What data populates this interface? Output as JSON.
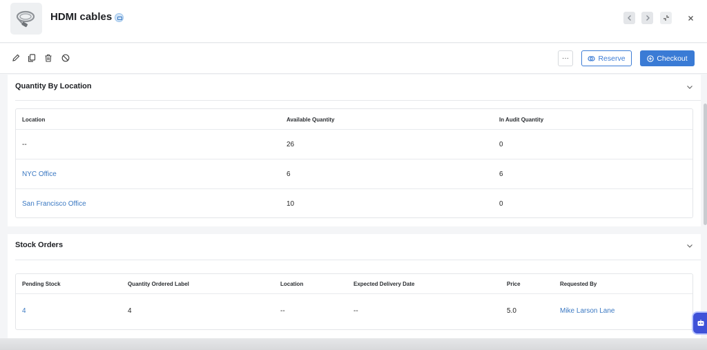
{
  "header": {
    "title": "HDMI cables",
    "thumbnail_icon": "hdmi-cable-icon",
    "prev_icon": "chevron-left-icon",
    "next_icon": "chevron-right-icon",
    "collapse_icon": "collapse-arrows-icon",
    "close_label": "×"
  },
  "toolbar": {
    "edit_icon": "pencil-icon",
    "duplicate_icon": "copy-icon",
    "delete_icon": "trash-icon",
    "disable_icon": "ban-icon",
    "more_label": "···",
    "reserve_label": "Reserve",
    "checkout_label": "Checkout",
    "accent_color": "#3a7bd5"
  },
  "quantity_by_location": {
    "title": "Quantity By Location",
    "columns": [
      "Location",
      "Available Quantity",
      "In Audit Quantity"
    ],
    "rows": [
      {
        "location": "--",
        "available": "26",
        "in_audit": "0"
      },
      {
        "location": "NYC Office",
        "available": "6",
        "in_audit": "6"
      },
      {
        "location": "San Francisco Office",
        "available": "10",
        "in_audit": "0"
      }
    ]
  },
  "stock_orders": {
    "title": "Stock Orders",
    "columns": [
      "Pending Stock",
      "Quantity Ordered Label",
      "Location",
      "Expected Delivery Date",
      "Price",
      "Requested By"
    ],
    "rows": [
      {
        "pending_stock": "4",
        "quantity_ordered": "4",
        "location": "--",
        "expected_delivery": "--",
        "price": "5.0",
        "requested_by": "Mike Larson Lane"
      }
    ]
  }
}
